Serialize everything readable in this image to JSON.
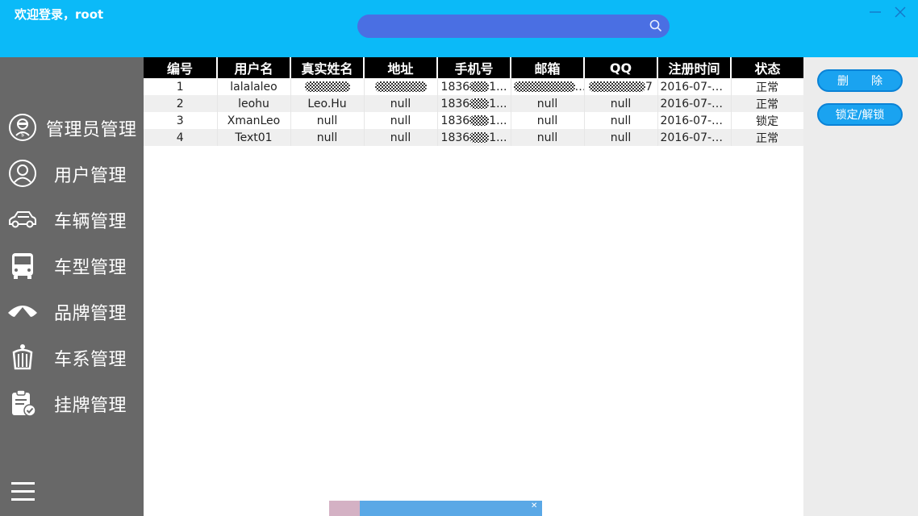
{
  "header": {
    "welcome": "欢迎登录，root",
    "search": {
      "value": "",
      "placeholder": ""
    }
  },
  "sidebar": {
    "items": [
      {
        "label": "管理员管理",
        "icon": "admin-icon"
      },
      {
        "label": "用户管理",
        "icon": "user-icon"
      },
      {
        "label": "车辆管理",
        "icon": "car-icon"
      },
      {
        "label": "车型管理",
        "icon": "bus-icon"
      },
      {
        "label": "品牌管理",
        "icon": "brand-logo-icon"
      },
      {
        "label": "车系管理",
        "icon": "crown-icon"
      },
      {
        "label": "挂牌管理",
        "icon": "clipboard-check-icon"
      }
    ],
    "menu_icon": "hamburger-menu-icon"
  },
  "table": {
    "columns": [
      "编号",
      "用户名",
      "真实姓名",
      "地址",
      "手机号",
      "邮箱",
      "QQ",
      "注册时间",
      "状态"
    ],
    "rows": [
      {
        "id": "1",
        "username": "lalalaleo",
        "real_name": "",
        "address": "",
        "phone_prefix": "1836",
        "phone_suffix": "1...",
        "email": "...",
        "qq": "7",
        "reg_time": "2016-07-1...",
        "status": "正常"
      },
      {
        "id": "2",
        "username": "leohu",
        "real_name": "Leo.Hu",
        "address": "null",
        "phone_prefix": "1836",
        "phone_suffix": "1...",
        "email": "null",
        "qq": "null",
        "reg_time": "2016-07-1...",
        "status": "正常"
      },
      {
        "id": "3",
        "username": "XmanLeo",
        "real_name": "null",
        "address": "null",
        "phone_prefix": "1836",
        "phone_suffix": "1...",
        "email": "null",
        "qq": "null",
        "reg_time": "2016-07-1...",
        "status": "锁定"
      },
      {
        "id": "4",
        "username": "Text01",
        "real_name": "null",
        "address": "null",
        "phone_prefix": "1836",
        "phone_suffix": "1...",
        "email": "null",
        "qq": "null",
        "reg_time": "2016-07-1...",
        "status": "正常"
      }
    ]
  },
  "actions": {
    "delete": "删　　除",
    "lock": "锁定/解锁"
  },
  "colors": {
    "header": "#0bbaf8",
    "search": "#4a6fe3",
    "sidebar": "#686868",
    "button": "#1aa3f0"
  }
}
